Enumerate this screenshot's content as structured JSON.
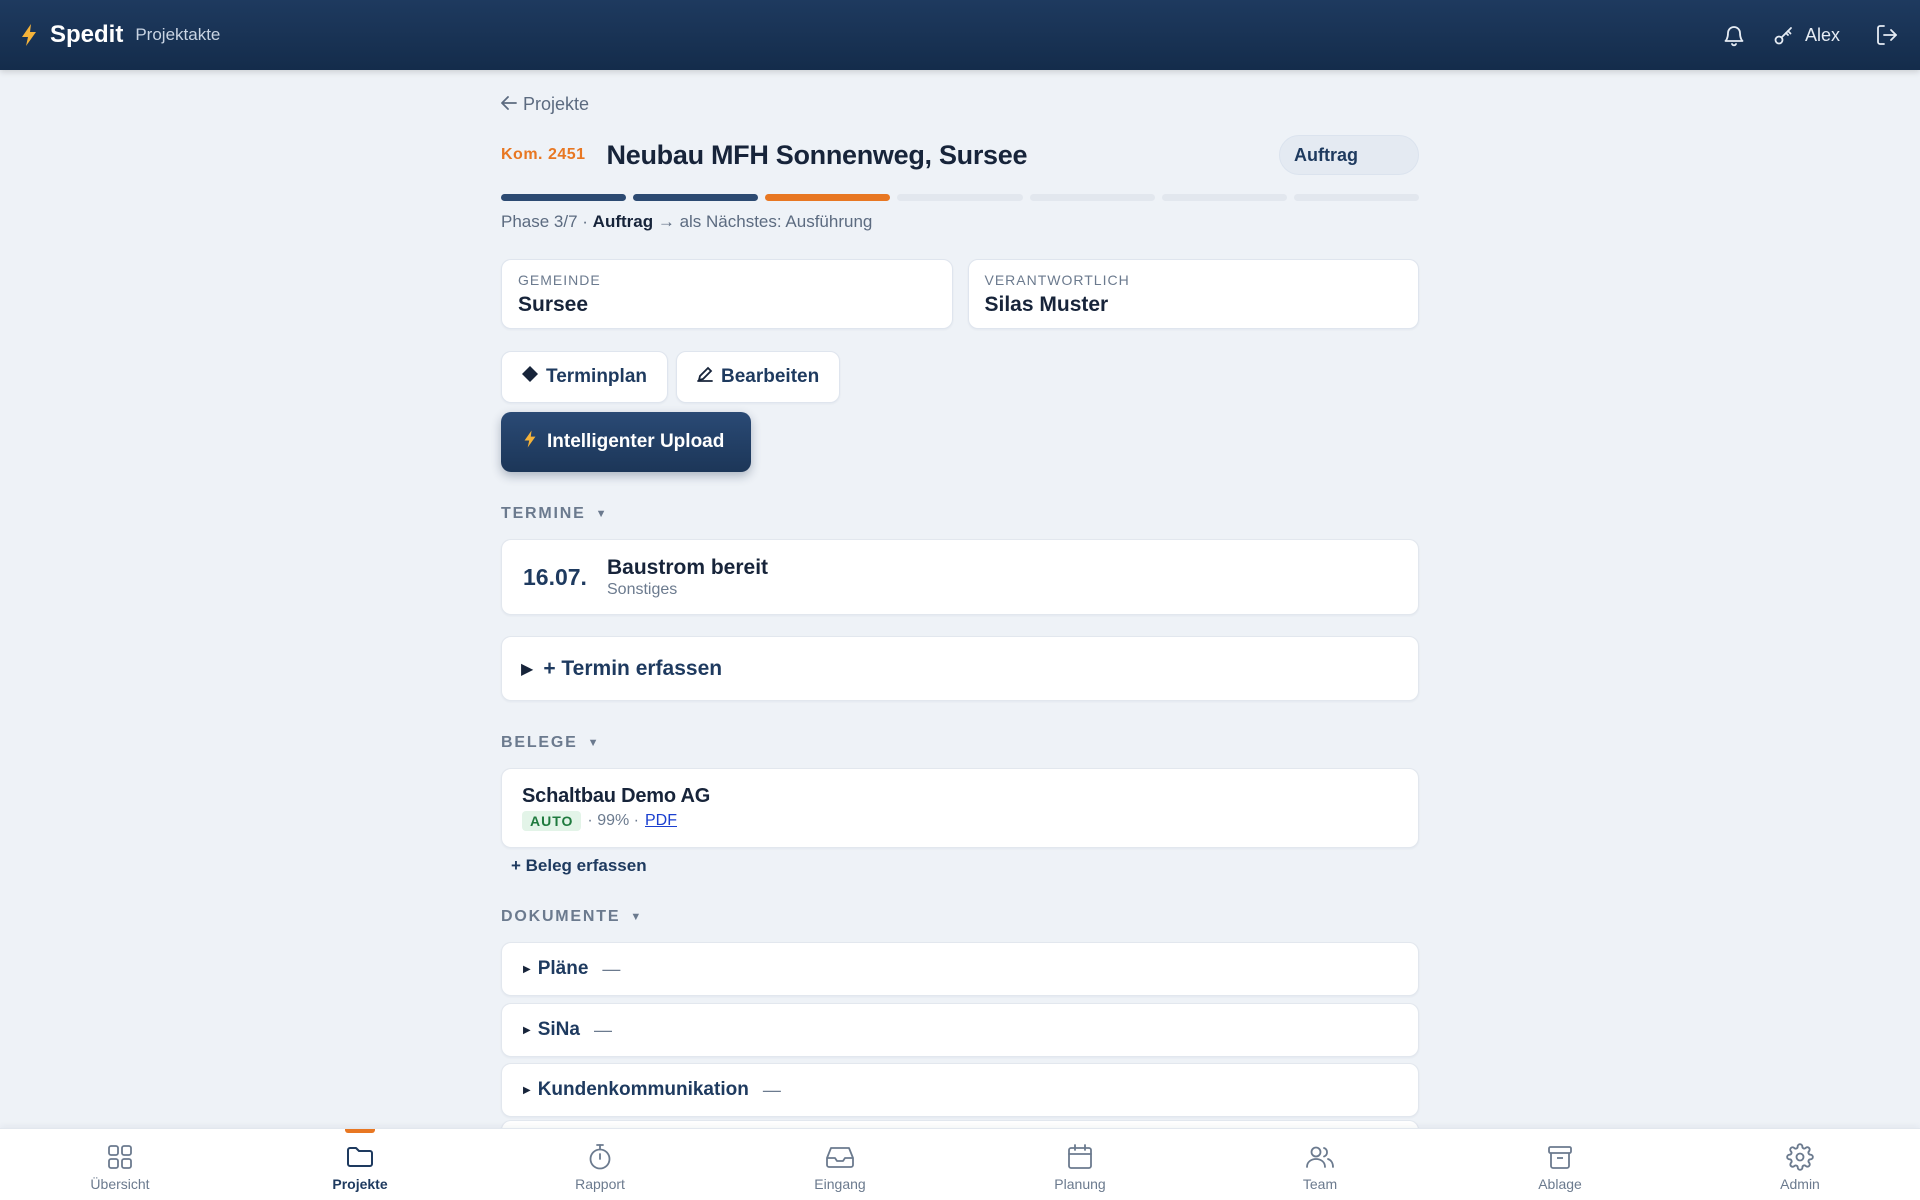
{
  "header": {
    "app_name": "Spedit",
    "subtitle": "Projektakte",
    "user_name": "Alex",
    "icons": [
      "bolt-icon",
      "bell-icon",
      "key-icon",
      "logout-icon"
    ],
    "colors": {
      "bar": "#1e3a5f",
      "accent": "#f5b33a"
    }
  },
  "project": {
    "back_label": "Projekte",
    "kom": "Kom. 2451",
    "title": "Neubau MFH Sonnenweg, Sursee",
    "phase_badge": "Auftrag",
    "phase_progress": {
      "current": 3,
      "total": 7
    },
    "phase_text_prefix": "Phase 3/7 · ",
    "phase_text_current": "Auftrag",
    "phase_text_suffix": " → als Nächstes: Ausführung",
    "gemeinde_label": "GEMEINDE",
    "gemeinde_value": "Sursee",
    "verantwortlich_label": "VERANTWORTLICH",
    "verantwortlich_value": "Silas Muster"
  },
  "actions": {
    "terminplan": "Terminplan",
    "bearbeiten": "Bearbeiten",
    "upload": "Intelligenter Upload"
  },
  "termine": {
    "heading": "TERMINE",
    "items": [
      {
        "date": "16.07.",
        "title": "Baustrom bereit",
        "category": "Sonstiges"
      }
    ],
    "add_label": "+ Termin erfassen"
  },
  "belege": {
    "heading": "BELEGE",
    "items": [
      {
        "name": "Schaltbau Demo AG",
        "badge": "AUTO",
        "confidence": "· 99% ·",
        "link": "PDF"
      }
    ],
    "add_label": "+ Beleg erfassen"
  },
  "dokumente": {
    "heading": "DOKUMENTE",
    "items": [
      {
        "label": "Pläne",
        "count": "—"
      },
      {
        "label": "SiNa",
        "count": "—"
      },
      {
        "label": "Kundenkommunikation",
        "count": "—"
      }
    ]
  },
  "bottom_nav": [
    {
      "label": "Übersicht",
      "icon": "grid-icon",
      "active": false
    },
    {
      "label": "Projekte",
      "icon": "folder-icon",
      "active": true
    },
    {
      "label": "Rapport",
      "icon": "stopwatch-icon",
      "active": false
    },
    {
      "label": "Eingang",
      "icon": "inbox-icon",
      "active": false
    },
    {
      "label": "Planung",
      "icon": "calendar-icon",
      "active": false
    },
    {
      "label": "Team",
      "icon": "team-icon",
      "active": false
    },
    {
      "label": "Ablage",
      "icon": "archive-icon",
      "active": false
    },
    {
      "label": "Admin",
      "icon": "gear-icon",
      "active": false
    }
  ],
  "colors": {
    "primary": "#1e3a5f",
    "accent_orange": "#e87722",
    "background": "#eef2f7",
    "auto_badge_bg": "#e3f4e8",
    "auto_badge_text": "#1f7a3e"
  }
}
